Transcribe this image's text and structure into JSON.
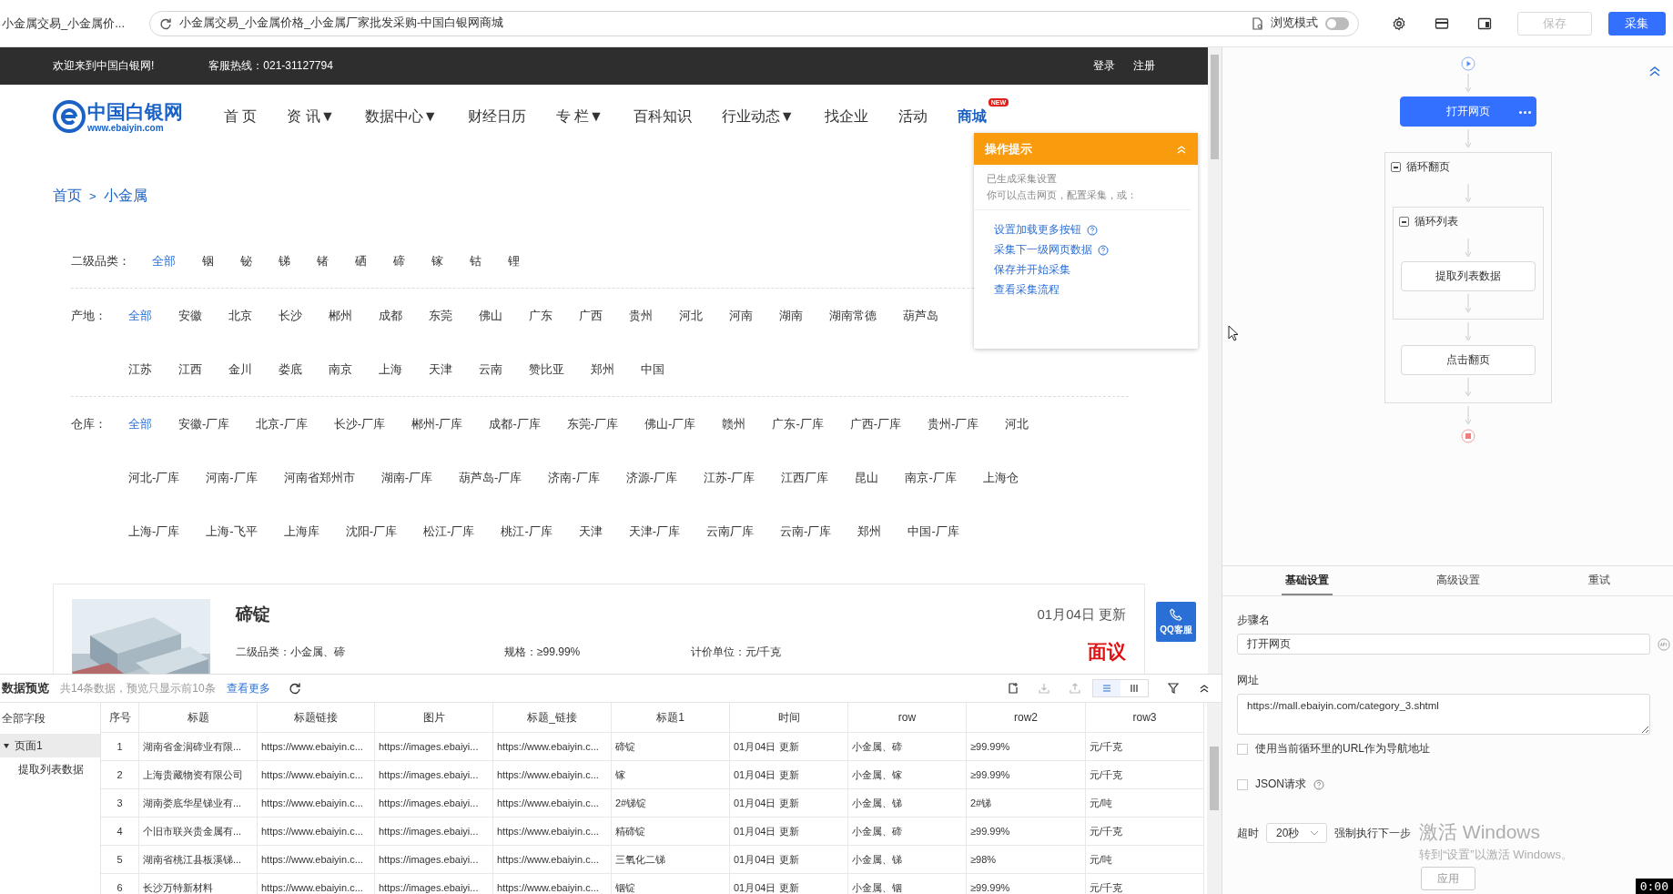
{
  "browser_tab": {
    "title": "小金属交易_小金属价..."
  },
  "address_bar": {
    "url": "小金属交易_小金属价格_小金属厂家批发采购-中国白银网商城"
  },
  "browse_mode": {
    "label": "浏览模式",
    "on": false
  },
  "toolbar_buttons": [
    {
      "label": "保存",
      "disabled": true
    },
    {
      "label": "采集",
      "disabled": false
    }
  ],
  "site": {
    "welcome": "欢迎来到中国白银网!",
    "hotline": "客服热线：021-31127794",
    "account_links": [
      "登录",
      "注册"
    ],
    "logo": {
      "name": "中国白银网",
      "domain": "www.ebaiyin.com"
    },
    "nav": [
      {
        "label": "首 页",
        "selected": false
      },
      {
        "label": "资 讯▼",
        "selected": false
      },
      {
        "label": "数据中心▼",
        "selected": false
      },
      {
        "label": "财经日历",
        "selected": false
      },
      {
        "label": "专 栏▼",
        "selected": false
      },
      {
        "label": "百科知识",
        "selected": false
      },
      {
        "label": "行业动态▼",
        "selected": false
      },
      {
        "label": "找企业",
        "selected": false
      },
      {
        "label": "活动",
        "selected": false
      },
      {
        "label": "商城",
        "selected": true,
        "badge": "NEW"
      }
    ],
    "breadcrumb": {
      "items": [
        "首页",
        "小金属"
      ],
      "separator": ">"
    },
    "filters": [
      {
        "label": "二级品类：",
        "option_rows": [
          [
            {
              "label": "全部",
              "selected": true
            },
            {
              "label": "铟",
              "selected": false
            },
            {
              "label": "铋",
              "selected": false
            },
            {
              "label": "锑",
              "selected": false
            },
            {
              "label": "锗",
              "selected": false
            },
            {
              "label": "硒",
              "selected": false
            },
            {
              "label": "碲",
              "selected": false
            },
            {
              "label": "镓",
              "selected": false
            },
            {
              "label": "钴",
              "selected": false
            },
            {
              "label": "锂",
              "selected": false
            }
          ]
        ]
      },
      {
        "label": "产地：",
        "option_rows": [
          [
            {
              "label": "全部",
              "selected": true
            },
            {
              "label": "安徽",
              "selected": false
            },
            {
              "label": "北京",
              "selected": false
            },
            {
              "label": "长沙",
              "selected": false
            },
            {
              "label": "郴州",
              "selected": false
            },
            {
              "label": "成都",
              "selected": false
            },
            {
              "label": "东莞",
              "selected": false
            },
            {
              "label": "佛山",
              "selected": false
            },
            {
              "label": "广东",
              "selected": false
            },
            {
              "label": "广西",
              "selected": false
            },
            {
              "label": "贵州",
              "selected": false
            },
            {
              "label": "河北",
              "selected": false
            },
            {
              "label": "河南",
              "selected": false
            },
            {
              "label": "湖南",
              "selected": false
            },
            {
              "label": "湖南常德",
              "selected": false
            },
            {
              "label": "葫芦岛",
              "selected": false
            }
          ],
          [
            {
              "label": "江苏",
              "selected": false
            },
            {
              "label": "江西",
              "selected": false
            },
            {
              "label": "金川",
              "selected": false
            },
            {
              "label": "娄底",
              "selected": false
            },
            {
              "label": "南京",
              "selected": false
            },
            {
              "label": "上海",
              "selected": false
            },
            {
              "label": "天津",
              "selected": false
            },
            {
              "label": "云南",
              "selected": false
            },
            {
              "label": "赞比亚",
              "selected": false
            },
            {
              "label": "郑州",
              "selected": false
            },
            {
              "label": "中国",
              "selected": false
            }
          ]
        ]
      },
      {
        "label": "仓库：",
        "option_rows": [
          [
            {
              "label": "全部",
              "selected": true
            },
            {
              "label": "安徽-厂库",
              "selected": false
            },
            {
              "label": "北京-厂库",
              "selected": false
            },
            {
              "label": "长沙-厂库",
              "selected": false
            },
            {
              "label": "郴州-厂库",
              "selected": false
            },
            {
              "label": "成都-厂库",
              "selected": false
            },
            {
              "label": "东莞-厂库",
              "selected": false
            },
            {
              "label": "佛山-厂库",
              "selected": false
            },
            {
              "label": "赣州",
              "selected": false
            },
            {
              "label": "广东-厂库",
              "selected": false
            },
            {
              "label": "广西-厂库",
              "selected": false
            },
            {
              "label": "贵州-厂库",
              "selected": false
            },
            {
              "label": "河北",
              "selected": false
            }
          ],
          [
            {
              "label": "河北-厂库",
              "selected": false
            },
            {
              "label": "河南-厂库",
              "selected": false
            },
            {
              "label": "河南省郑州市",
              "selected": false
            },
            {
              "label": "湖南-厂库",
              "selected": false
            },
            {
              "label": "葫芦岛-厂库",
              "selected": false
            },
            {
              "label": "济南-厂库",
              "selected": false
            },
            {
              "label": "济源-厂库",
              "selected": false
            },
            {
              "label": "江苏-厂库",
              "selected": false
            },
            {
              "label": "江西厂库",
              "selected": false
            },
            {
              "label": "昆山",
              "selected": false
            },
            {
              "label": "南京-厂库",
              "selected": false
            },
            {
              "label": "上海仓",
              "selected": false
            }
          ],
          [
            {
              "label": "上海-厂库",
              "selected": false
            },
            {
              "label": "上海-飞平",
              "selected": false
            },
            {
              "label": "上海库",
              "selected": false
            },
            {
              "label": "沈阳-厂库",
              "selected": false
            },
            {
              "label": "松江-厂库",
              "selected": false
            },
            {
              "label": "桃江-厂库",
              "selected": false
            },
            {
              "label": "天津",
              "selected": false
            },
            {
              "label": "天津-厂库",
              "selected": false
            },
            {
              "label": "云南厂库",
              "selected": false
            },
            {
              "label": "云南-厂库",
              "selected": false
            },
            {
              "label": "郑州",
              "selected": false
            },
            {
              "label": "中国-厂库",
              "selected": false
            }
          ]
        ]
      }
    ],
    "product": {
      "title": "碲锭",
      "date": "01月04日 更新",
      "fields": [
        {
          "label": "二级品类：",
          "value": "小金属、碲"
        },
        {
          "label": "规格：",
          "value": "≥99.99%"
        },
        {
          "label": "计价单位：",
          "value": "元/千克"
        }
      ],
      "price": "面议"
    },
    "qq_button": {
      "label": "QQ客服"
    }
  },
  "guide": {
    "title": "操作提示",
    "lines": [
      "已生成采集设置",
      "你可以点击网页，配置采集，或："
    ],
    "links": [
      {
        "label": "设置加载更多按钮",
        "help": true
      },
      {
        "label": "采集下一级网页数据",
        "help": true
      },
      {
        "label": "保存并开始采集",
        "help": false
      },
      {
        "label": "查看采集流程",
        "help": false
      }
    ]
  },
  "data_preview": {
    "title": "数据预览",
    "summary": "共14条数据，预览只显示前10条",
    "more_link": "查看更多",
    "view_modes": [
      {
        "kind": "list",
        "selected": true
      },
      {
        "kind": "columns",
        "selected": false
      }
    ],
    "field_tree": {
      "root": "全部字段",
      "pages": [
        {
          "label": "页面1",
          "selected": true,
          "expanded": true,
          "children": [
            {
              "label": "提取列表数据"
            }
          ]
        }
      ]
    },
    "table": {
      "columns": [
        "序号",
        "标题",
        "标题链接",
        "图片",
        "标题_链接",
        "标题1",
        "时间",
        "row",
        "row2",
        "row3"
      ],
      "rows": [
        [
          "1",
          "湖南省金润碲业有限...",
          "https://www.ebaiyin.c...",
          "https://images.ebaiyi...",
          "https://www.ebaiyin.c...",
          "碲锭",
          "01月04日 更新",
          "小金属、碲",
          "≥99.99%",
          "元/千克"
        ],
        [
          "2",
          "上海贵藏物资有限公司",
          "https://www.ebaiyin.c...",
          "https://images.ebaiyi...",
          "https://www.ebaiyin.c...",
          "镓",
          "01月04日 更新",
          "小金属、镓",
          "≥99.99%",
          "元/千克"
        ],
        [
          "3",
          "湖南娄底华星锑业有...",
          "https://www.ebaiyin.c...",
          "https://images.ebaiyi...",
          "https://www.ebaiyin.c...",
          "2#锑锭",
          "01月04日 更新",
          "小金属、锑",
          "2#锑",
          "元/吨"
        ],
        [
          "4",
          "个旧市联兴贵金属有...",
          "https://www.ebaiyin.c...",
          "https://images.ebaiyi...",
          "https://www.ebaiyin.c...",
          "精碲锭",
          "01月04日 更新",
          "小金属、碲",
          "≥99.99%",
          "元/千克"
        ],
        [
          "5",
          "湖南省桃江县板溪锑...",
          "https://www.ebaiyin.c...",
          "https://images.ebaiyi...",
          "https://www.ebaiyin.c...",
          "三氧化二锑",
          "01月04日 更新",
          "小金属、锑",
          "≥98%",
          "元/吨"
        ],
        [
          "6",
          "长沙万特新材料",
          "https://www.ebaiyin.c...",
          "https://images.ebaiyi...",
          "https://www.ebaiyin.c...",
          "铟锭",
          "01月04日 更新",
          "小金属、铟",
          "≥99.99%",
          "元/千克"
        ]
      ]
    }
  },
  "workflow": {
    "steps": [
      {
        "kind": "action",
        "label": "打开网页",
        "selected": true
      },
      {
        "kind": "loop",
        "label": "循环翻页",
        "expanded": true,
        "children": [
          {
            "kind": "loop",
            "label": "循环列表",
            "expanded": true,
            "children": [
              {
                "kind": "action",
                "label": "提取列表数据",
                "selected": false
              }
            ]
          },
          {
            "kind": "action",
            "label": "点击翻页",
            "selected": false
          }
        ]
      }
    ]
  },
  "settings": {
    "tabs": [
      {
        "label": "基础设置",
        "selected": true
      },
      {
        "label": "高级设置",
        "selected": false
      },
      {
        "label": "重试",
        "selected": false
      }
    ],
    "step_name": {
      "label": "步骤名",
      "value": "打开网页"
    },
    "url": {
      "label": "网址",
      "value": "https://mall.ebaiyin.com/category_3.shtml"
    },
    "options": [
      {
        "label": "使用当前循环里的URL作为导航地址",
        "checked": false,
        "help": false
      },
      {
        "label": "JSON请求",
        "checked": false,
        "help": true
      }
    ],
    "timeout": {
      "label": "超时",
      "value": "20秒",
      "suffix": "强制执行下一步"
    },
    "apply_button": "应用"
  },
  "os_overlay": {
    "activation_title": "激活 Windows",
    "activation_hint": "转到“设置”以激活 Windows。",
    "timer": "0:00"
  }
}
